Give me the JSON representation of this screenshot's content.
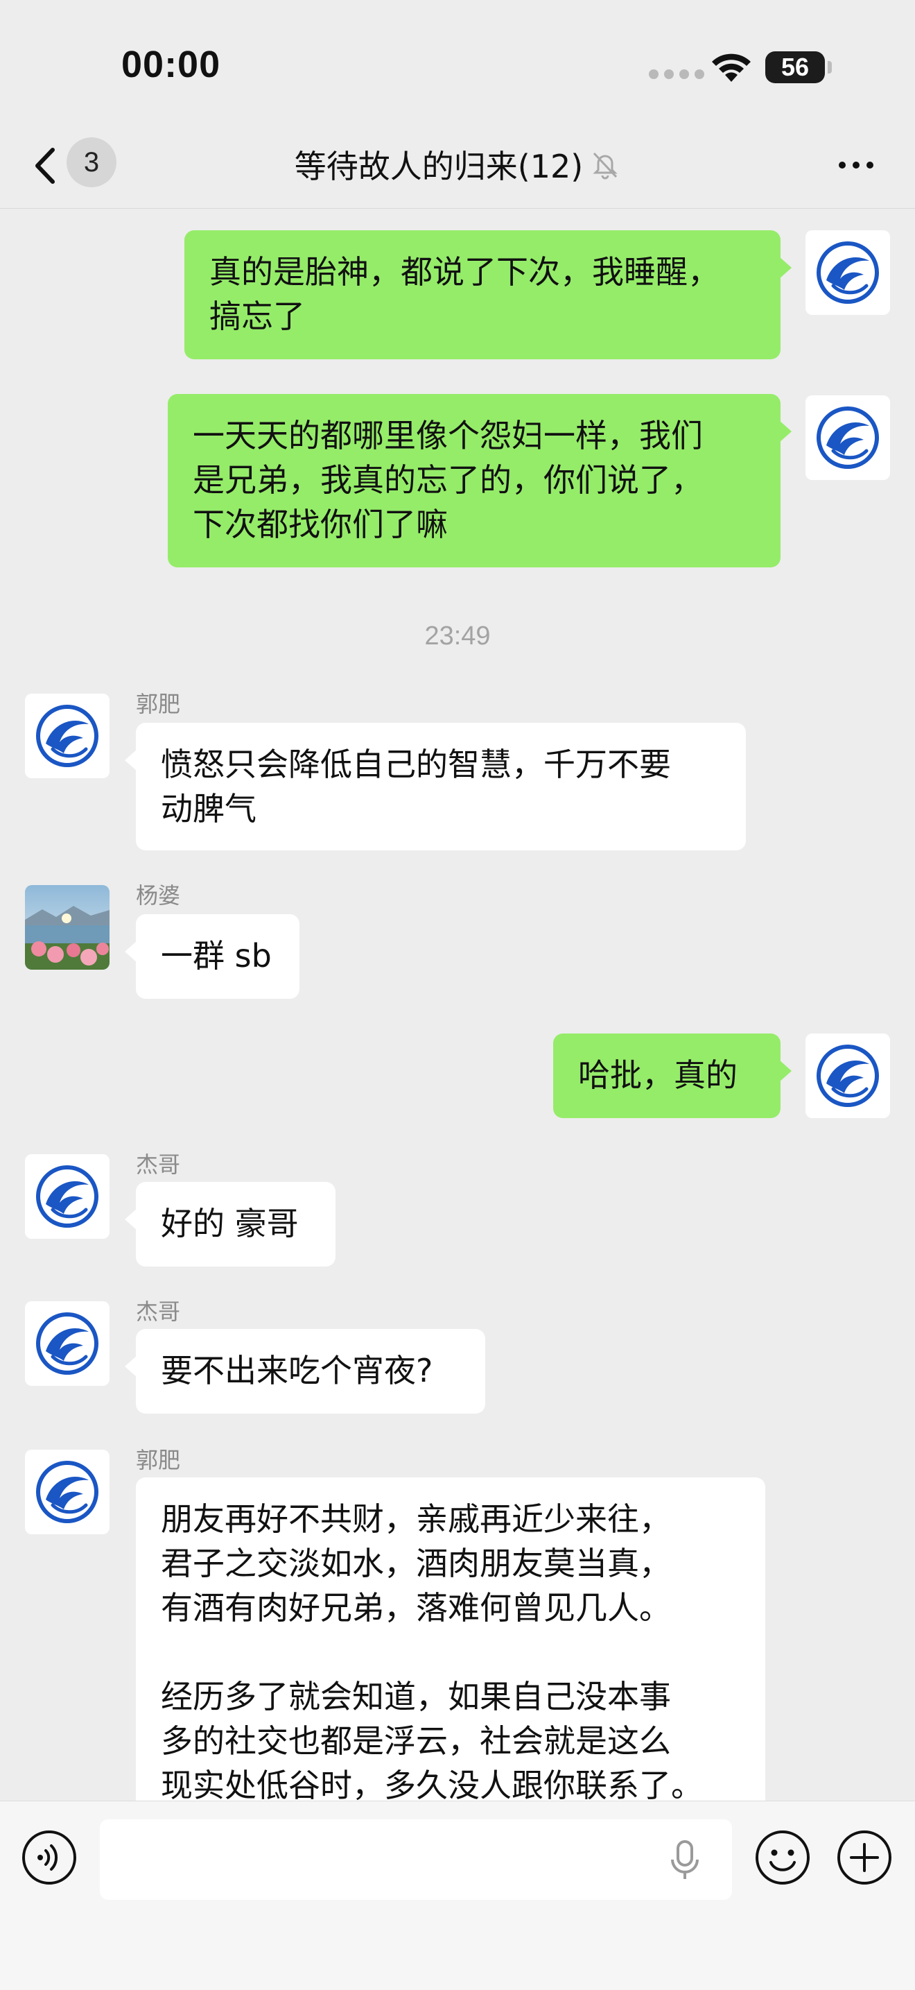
{
  "status_bar": {
    "time": "00:00",
    "battery": "56"
  },
  "nav": {
    "unread_count": "3",
    "title": "等待故人的归来(12)"
  },
  "messages": [
    {
      "side": "mine",
      "text": "真的是胎神，都说了下次，我睡醒，\n搞忘了"
    },
    {
      "side": "mine",
      "text": "一天天的都哪里像个怨妇一样，我们\n是兄弟，我真的忘了的，你们说了，\n下次都找你们了嘛"
    },
    {
      "side": "theirs",
      "sender": "郭肥",
      "text": "愤怒只会降低自己的智慧，千万不要\n动脾气"
    },
    {
      "side": "theirs",
      "sender": "杨婆",
      "text": "一群 sb"
    },
    {
      "side": "mine",
      "text": "哈批，真的"
    },
    {
      "side": "theirs",
      "sender": "杰哥",
      "text": "好的 豪哥"
    },
    {
      "side": "theirs",
      "sender": "杰哥",
      "text": "要不出来吃个宵夜?"
    },
    {
      "side": "theirs",
      "sender": "郭肥",
      "text": "朋友再好不共财，亲戚再近少来往，\n君子之交淡如水，酒肉朋友莫当真，\n有酒有肉好兄弟，落难何曾见几人。\n\n经历多了就会知道，如果自己没本事\n多的社交也都是浮云，社会就是这么\n现实处低谷时，多久没人跟你联系了。"
    }
  ],
  "timestamp": "23:49",
  "input": {
    "value": "",
    "placeholder": ""
  },
  "icons": {
    "back": "chevron-left-icon",
    "mute": "bell-slash-icon",
    "more": "more-dots-icon",
    "voice": "voice-icon",
    "mic": "microphone-icon",
    "emoji": "emoji-icon",
    "add": "plus-circle-icon"
  },
  "colors": {
    "my_bubble": "#95ec69",
    "their_bubble": "#ffffff",
    "background": "#ededed",
    "avatar_blue": "#1a56c4"
  }
}
